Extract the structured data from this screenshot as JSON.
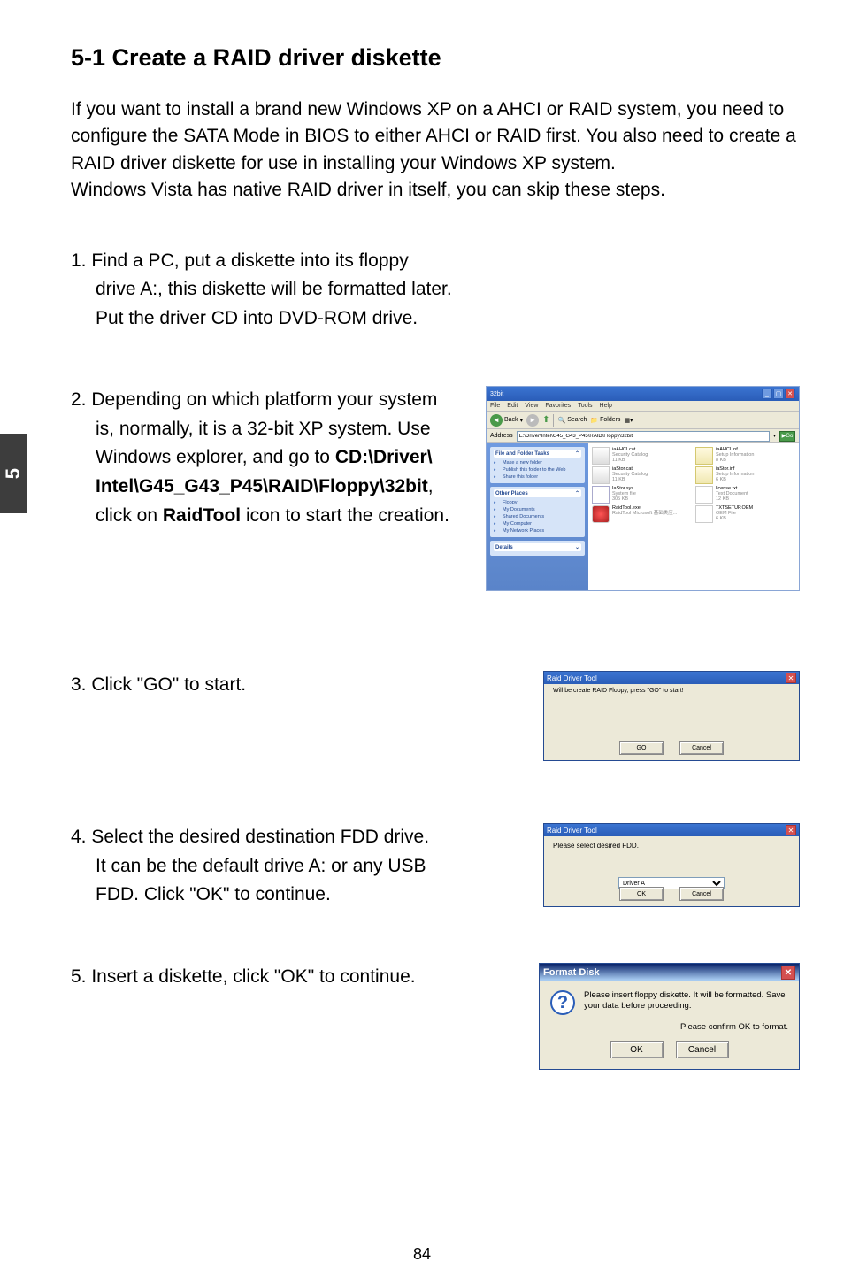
{
  "chapterTab": "5",
  "heading": "5-1 Create a RAID driver diskette",
  "intro": "If you want to install a brand new Windows XP on a AHCI or RAID system, you need to configure the SATA Mode in BIOS to either AHCI or RAID first. You also need to create a RAID driver diskette for use in installing your Windows XP system.\nWindows Vista has native RAID driver in itself, you can skip these steps.",
  "step1": {
    "num": "1. ",
    "line1": "Find a PC, put a diskette into its floppy",
    "line2": "drive A:, this diskette will be formatted later.",
    "line3": "Put the driver CD into DVD-ROM drive."
  },
  "step2": {
    "num": "2. ",
    "line1": "Depending on which platform your system",
    "line2": "is, normally, it is a 32-bit XP system. Use",
    "line3a": "Windows explorer, and go to ",
    "line3b": "CD:\\Driver\\",
    "line4b": "Intel\\G45_G43_P45\\RAID\\Floppy\\32bit",
    "line4c": ",",
    "line5a": "click on ",
    "line5b": "RaidTool",
    "line5c": " icon to start the creation."
  },
  "step3": {
    "text": "3. Click \"GO\" to start."
  },
  "step4": {
    "num": "4. ",
    "line1": "Select the desired destination FDD drive.",
    "line2": "It can be the default drive A: or any USB",
    "line3": "FDD. Click \"OK\" to continue."
  },
  "step5": {
    "text": "5. Insert a diskette, click \"OK\" to continue."
  },
  "explorer": {
    "title": "32bit",
    "menu": {
      "file": "File",
      "edit": "Edit",
      "view": "View",
      "favorites": "Favorites",
      "tools": "Tools",
      "help": "Help"
    },
    "toolbar": {
      "back": "Back",
      "search": "Search",
      "folders": "Folders"
    },
    "addressLabel": "Address",
    "addressValue": "E:\\Driver\\Intel\\G45_G43_P45\\RAID\\Floppy\\32bit",
    "go": "Go",
    "panels": {
      "fileFolder": {
        "title": "File and Folder Tasks",
        "items": [
          "Make a new folder",
          "Publish this folder to the Web",
          "Share this folder"
        ]
      },
      "otherPlaces": {
        "title": "Other Places",
        "items": [
          "Floppy",
          "My Documents",
          "Shared Documents",
          "My Computer",
          "My Network Places"
        ]
      },
      "details": {
        "title": "Details"
      }
    },
    "files": [
      {
        "name": "iaAHCI.cat",
        "desc": "Security Catalog",
        "size": "11 KB",
        "icon": "cat"
      },
      {
        "name": "iaAHCI.inf",
        "desc": "Setup Information",
        "size": "8 KB",
        "icon": "inf"
      },
      {
        "name": "iaStor.cat",
        "desc": "Security Catalog",
        "size": "11 KB",
        "icon": "cat"
      },
      {
        "name": "iaStor.inf",
        "desc": "Setup Information",
        "size": "6 KB",
        "icon": "inf"
      },
      {
        "name": "IaStor.sys",
        "desc": "System file",
        "size": "305 KB",
        "icon": "sys"
      },
      {
        "name": "license.txt",
        "desc": "Text Document",
        "size": "12 KB",
        "icon": "txt"
      },
      {
        "name": "RaidTool.exe",
        "desc": "RaidTool Microsoft 基础类应...",
        "size": "",
        "icon": "exe"
      },
      {
        "name": "TXTSETUP.OEM",
        "desc": "OEM File",
        "size": "6 KB",
        "icon": "oem"
      }
    ]
  },
  "dlg3": {
    "title": "Raid Driver Tool",
    "msg": "Will be create RAID Floppy, press \"GO\" to start!",
    "go": "GO",
    "cancel": "Cancel"
  },
  "dlg4": {
    "title": "Raid Driver Tool",
    "msg": "Please select desired FDD.",
    "option": "Driver A",
    "ok": "OK",
    "cancel": "Cancel"
  },
  "fmtdlg": {
    "title": "Format Disk",
    "msg": "Please insert floppy diskette.  It will be formatted.  Save your data before proceeding.",
    "confirm": "Please confirm OK to format.",
    "ok": "OK",
    "cancel": "Cancel"
  },
  "pageNumber": "84"
}
